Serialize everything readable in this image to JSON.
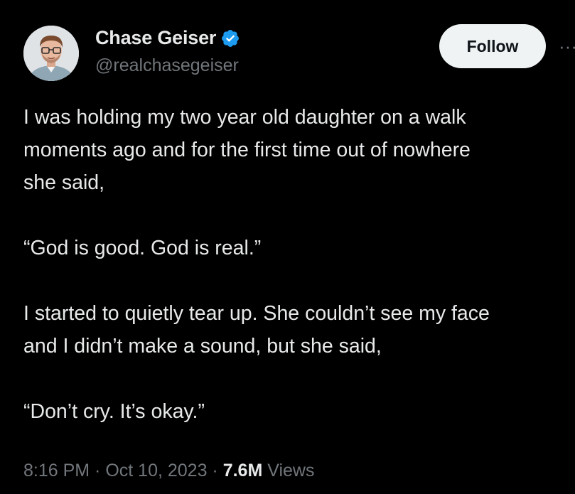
{
  "author": {
    "display_name": "Chase Geiser",
    "handle": "@realchasegeiser",
    "verified_icon": "verified-badge-icon",
    "avatar_icon": "avatar"
  },
  "actions": {
    "follow_label": "Follow",
    "more_label": "···"
  },
  "tweet": {
    "paragraphs": [
      "I was holding my two year old daughter on a walk\nmoments ago and for the first time out of nowhere\nshe said,",
      "“God is good. God is real.”",
      "I started to quietly tear up. She couldn’t see my face\nand I didn’t make a sound, but she said,",
      "“Don’t cry. It’s okay.”"
    ]
  },
  "meta": {
    "time": "8:16 PM",
    "separator": " · ",
    "date": "Oct 10, 2023",
    "views_count": "7.6M",
    "views_label": "Views"
  },
  "colors": {
    "background": "#000000",
    "text": "#e7e9ea",
    "secondary": "#71767b",
    "verified": "#1d9bf0",
    "follow_bg": "#eff3f4"
  }
}
